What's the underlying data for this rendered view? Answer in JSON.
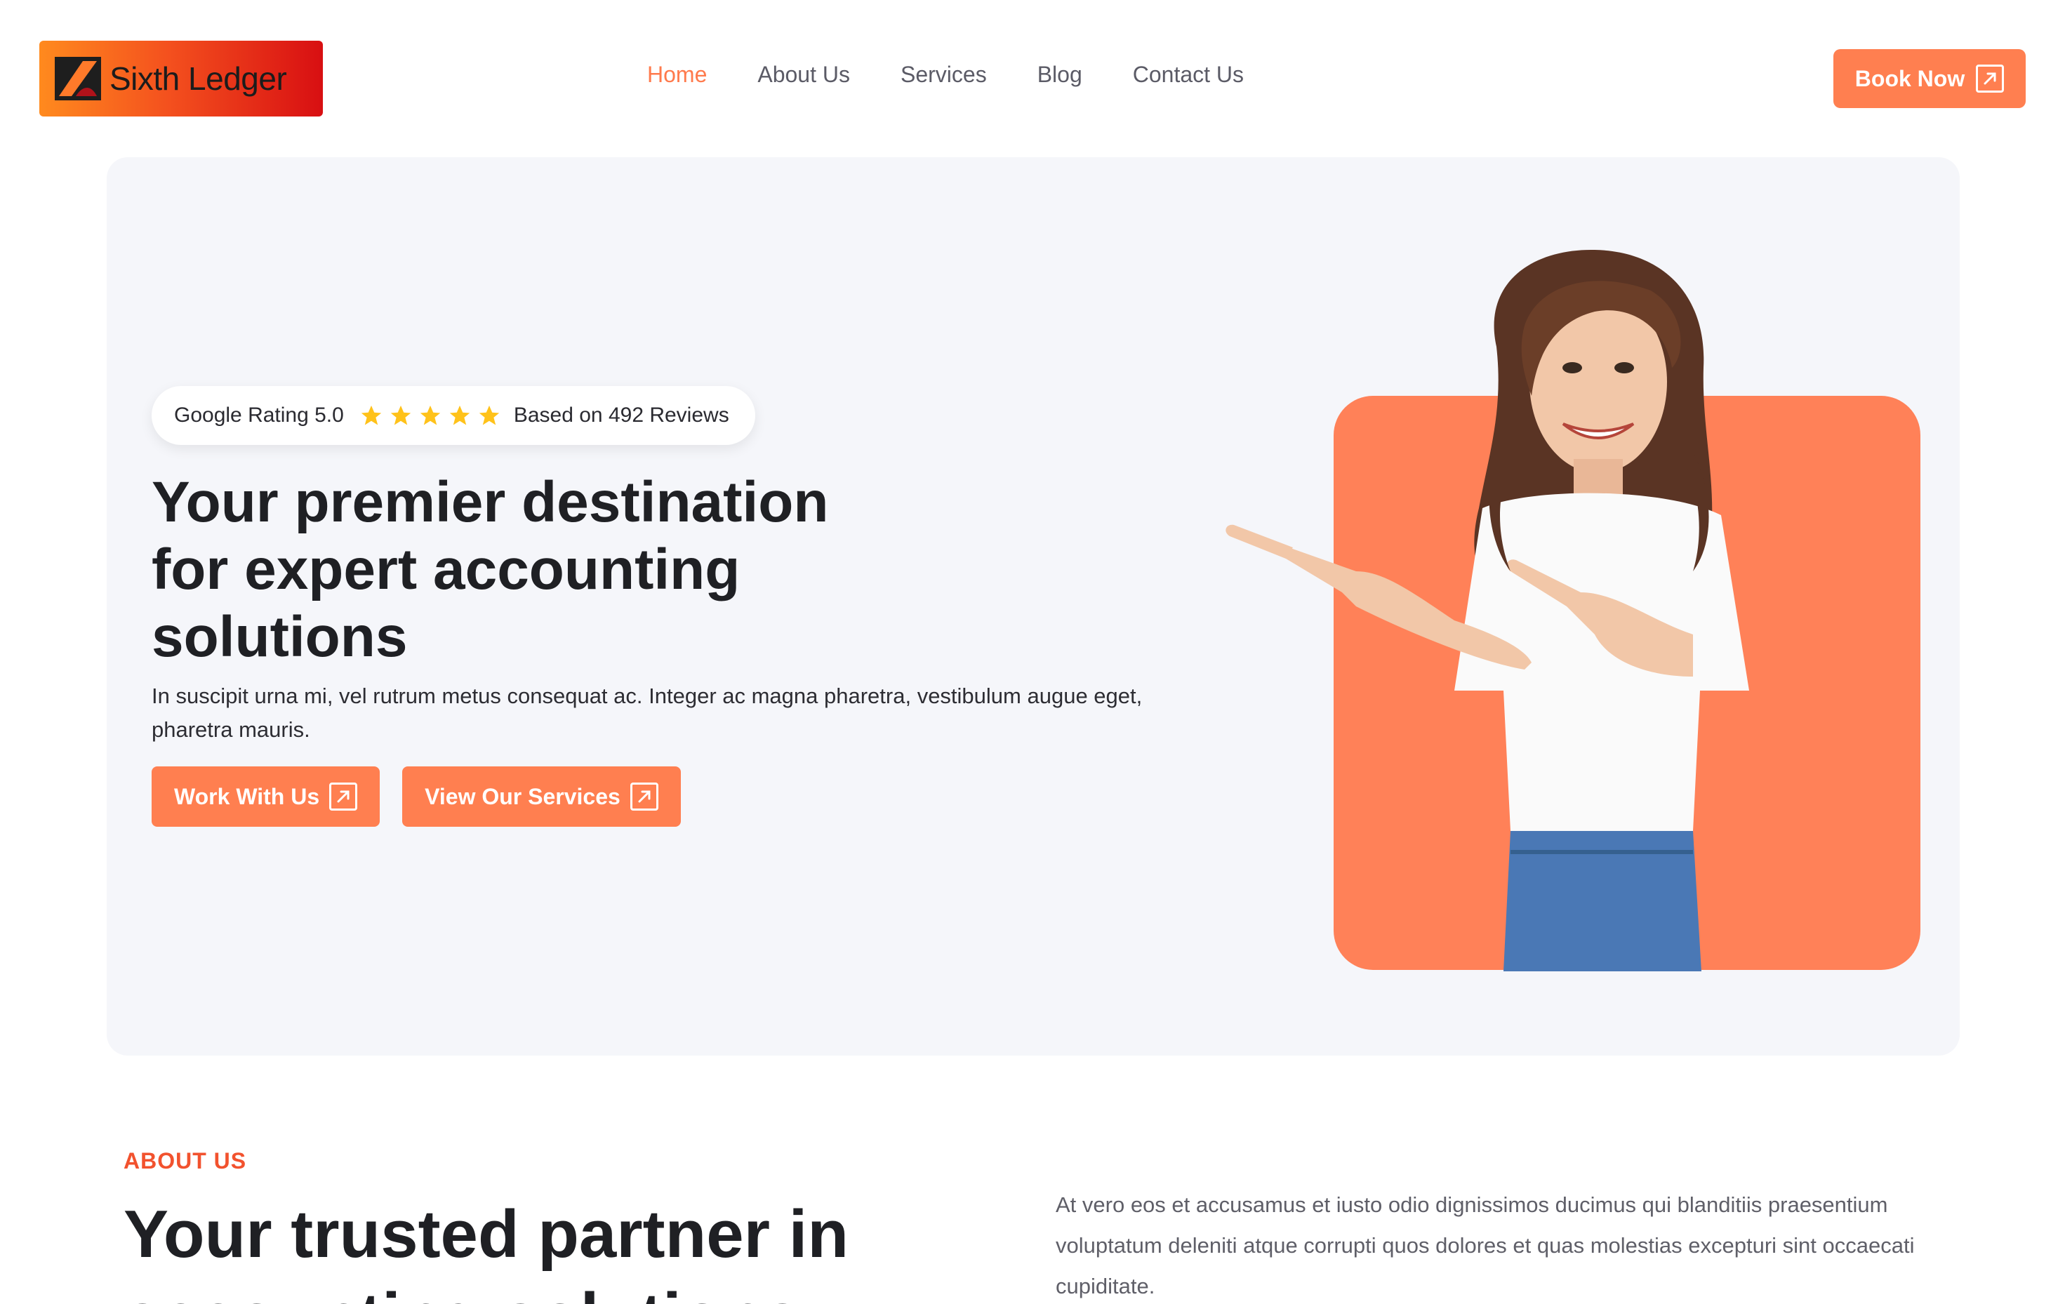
{
  "header": {
    "logo_text": "Sixth Ledger",
    "nav": [
      {
        "label": "Home",
        "active": true
      },
      {
        "label": "About Us",
        "active": false
      },
      {
        "label": "Services",
        "active": false
      },
      {
        "label": "Blog",
        "active": false
      },
      {
        "label": "Contact Us",
        "active": false
      }
    ],
    "book_label": "Book Now",
    "book_icon": "arrow-up-right-icon"
  },
  "hero": {
    "rating_label": "Google Rating 5.0",
    "rating_stars": 5,
    "reviews_label": "Based on 492 Reviews",
    "title": "Your premier destination for expert accounting solutions",
    "description": "In suscipit urna mi, vel rutrum metus consequat ac. Integer ac magna pharetra, vestibulum augue eget, pharetra mauris.",
    "buttons": [
      {
        "label": "Work With Us",
        "icon": "arrow-up-right-icon"
      },
      {
        "label": "View Our Services",
        "icon": "arrow-up-right-icon"
      }
    ]
  },
  "about": {
    "eyebrow": "ABOUT US",
    "title": "Your trusted partner in accounting solutions",
    "text": "At vero eos et accusamus et iusto odio dignissimos ducimus qui blanditiis praesentium voluptatum deleniti atque corrupti quos dolores et quas molestias excepturi sint occaecati cupiditate."
  },
  "colors": {
    "accent": "#ff7f50",
    "eyebrow": "#f2522e",
    "hero_bg": "#f5f6fa",
    "star": "#ffc21a"
  }
}
